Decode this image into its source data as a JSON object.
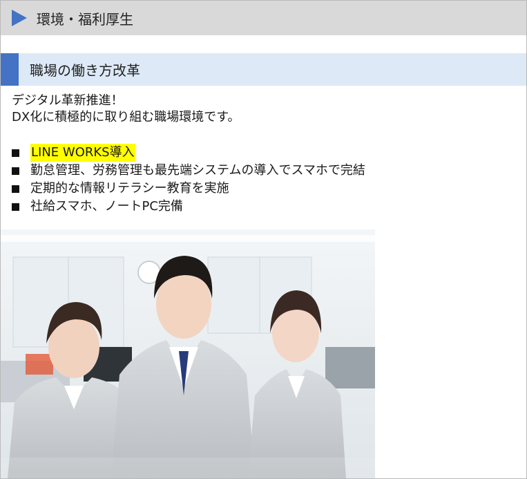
{
  "section": {
    "title": "環境・福利厚生",
    "icon": "triangle-right-icon",
    "accent": "#4472c4"
  },
  "subsection": {
    "title": "職場の働き方改革"
  },
  "intro": {
    "line1": "デジタル革新推進！",
    "line2": "DX化に積極的に取り組む職場環境です。"
  },
  "bullets": [
    {
      "text": "LINE WORKS導入",
      "highlight": true
    },
    {
      "text": "勤怠管理、労務管理も最先端システムの導入でスマホで完結",
      "highlight": false
    },
    {
      "text": "定期的な情報リテラシー教育を実施",
      "highlight": false
    },
    {
      "text": "社給スマホ、ノートPC完備",
      "highlight": false
    }
  ],
  "photo": {
    "subject": "three smiling office workers in gray work jackets"
  },
  "colors": {
    "header_bg": "#d9d9d9",
    "subheader_bg": "#dde9f6",
    "highlight": "#ffff00"
  }
}
